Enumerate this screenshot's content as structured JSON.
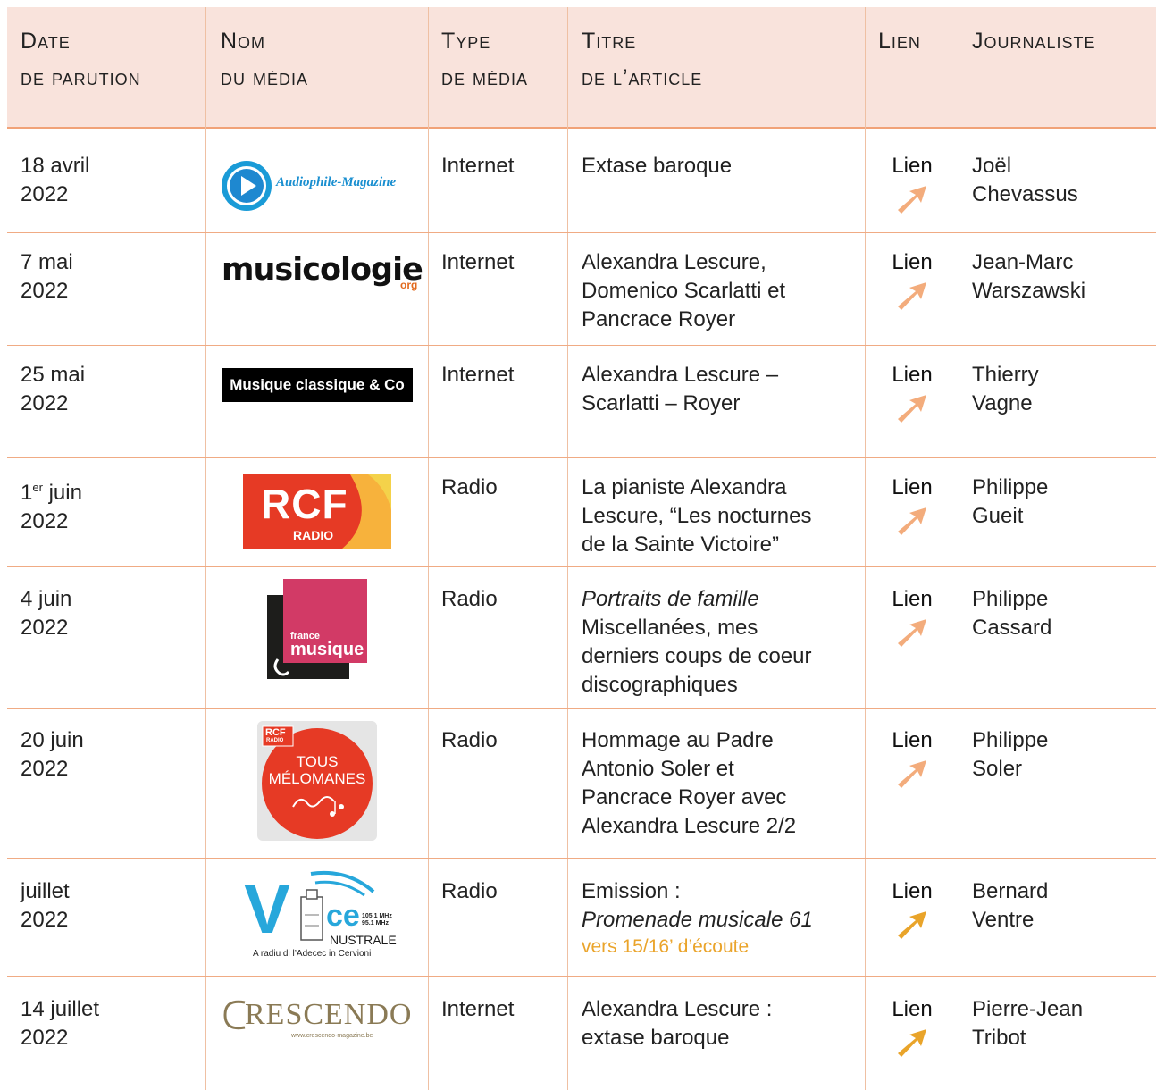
{
  "headers": {
    "date": {
      "l1": "Date",
      "l2": "de parution"
    },
    "media": {
      "l1": "Nom",
      "l2": "du média"
    },
    "type": {
      "l1": "Type",
      "l2": "de média"
    },
    "title": {
      "l1": "Titre",
      "l2": "de l’article"
    },
    "link": {
      "l1": "Lien"
    },
    "journalist": {
      "l1": "Journaliste"
    }
  },
  "rows": [
    {
      "date1": "18 avril",
      "date2": "2022",
      "logo": "Audiophile-Magazine",
      "type": "Internet",
      "title": [
        "Extase baroque"
      ],
      "link": "Lien",
      "journalist": [
        "Joël",
        "Chevassus"
      ]
    },
    {
      "date1": "7 mai",
      "date2": "2022",
      "logo": "musicologie",
      "logo_sub": "org",
      "type": "Internet",
      "title": [
        "Alexandra Lescure,",
        "Domenico Scarlatti et",
        "Pancrace Royer"
      ],
      "link": "Lien",
      "journalist": [
        "Jean-Marc",
        "Warszawski"
      ]
    },
    {
      "date1": "25 mai",
      "date2": "2022",
      "logo": "Musique classique & Co",
      "type": "Internet",
      "title": [
        "Alexandra Lescure –",
        "Scarlatti – Royer"
      ],
      "link": "Lien",
      "journalist": [
        "Thierry",
        "Vagne"
      ]
    },
    {
      "date1": "1",
      "date1_sup": "er",
      "date1_rest": " juin",
      "date2": "2022",
      "logo": "RCF",
      "logo_sub": "RADIO",
      "type": "Radio",
      "title": [
        "La pianiste Alexandra",
        "Lescure, “Les nocturnes",
        "de la Sainte Victoire”"
      ],
      "link": "Lien",
      "journalist": [
        "Philippe",
        "Gueit"
      ]
    },
    {
      "date1": "4 juin",
      "date2": "2022",
      "logo": "musique",
      "logo_sub": "france",
      "type": "Radio",
      "title_italic": "Portraits de famille",
      "title": [
        "Miscellanées, mes",
        "derniers coups de coeur",
        "discographiques"
      ],
      "link": "Lien",
      "journalist": [
        "Philippe",
        "Cassard"
      ]
    },
    {
      "date1": "20 juin",
      "date2": "2022",
      "logo_l1": "TOUS",
      "logo_l2": "MÉLOMANES",
      "logo_badge": "RCF",
      "logo_badge_sub": "RADIO",
      "type": "Radio",
      "title": [
        "Hommage au Padre",
        "Antonio Soler et",
        "Pancrace Royer avec",
        "Alexandra Lescure 2/2"
      ],
      "link": "Lien",
      "journalist": [
        "Philippe",
        "Soler"
      ]
    },
    {
      "date1": "juillet",
      "date2": "2022",
      "logo_v": "V",
      "logo_ce": "ce",
      "logo_freq1": "105.1 MHz",
      "logo_freq2": "95.1 MHz",
      "logo_nustrale": "NUSTRALE",
      "logo_tag": "A radiu di l’Adecec in Cervioni",
      "type": "Radio",
      "title": [
        "Emission :"
      ],
      "title_italic2": "Promenade musicale 61",
      "note": "vers 15/16’ d’écoute",
      "link": "Lien",
      "journalist": [
        "Bernard",
        "Ventre"
      ]
    },
    {
      "date1": "14 juillet",
      "date2": "2022",
      "logo": "RESCENDO",
      "logo_url": "www.crescendo-magazine.be",
      "type": "Internet",
      "title": [
        "Alexandra Lescure :",
        "extase baroque"
      ],
      "link": "Lien",
      "journalist": [
        "Pierre-Jean",
        "Tribot"
      ]
    }
  ],
  "colors": {
    "header_bg": "#f9e3dc",
    "rule": "#f0ab84",
    "arrow_light": "#f3ac7c",
    "arrow_gold": "#e9a42a",
    "note": "#eaa42b"
  }
}
